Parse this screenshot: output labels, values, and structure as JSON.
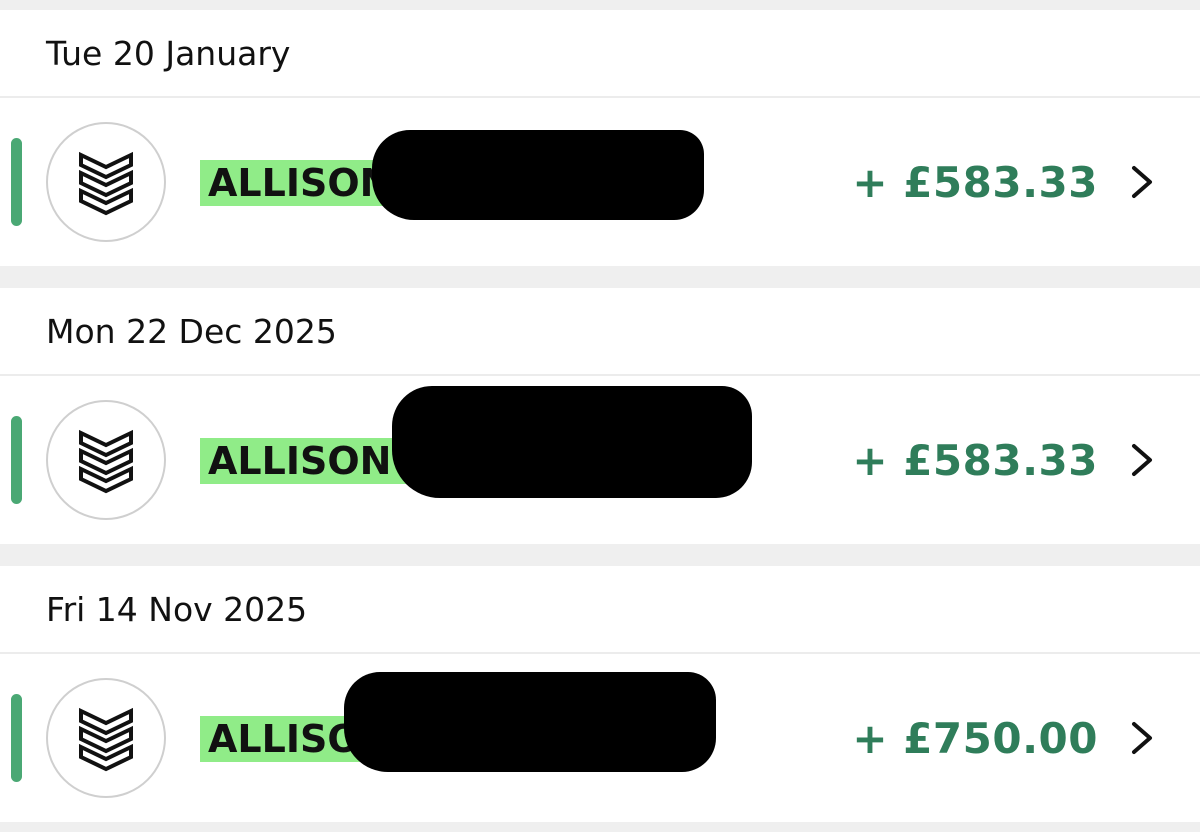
{
  "colors": {
    "accent": "#4aa874",
    "amount": "#2f7d5a",
    "highlight": "#90ec88",
    "redaction": "#000000"
  },
  "transactions": [
    {
      "date": "Tue 20 January",
      "payee": "ALLISON",
      "amount": "+ £583.33",
      "icon": "chevron-stack-icon",
      "action_icon": "chevron-right-icon"
    },
    {
      "date": "Mon 22 Dec 2025",
      "payee": "ALLISON",
      "amount": "+ £583.33",
      "icon": "chevron-stack-icon",
      "action_icon": "chevron-right-icon"
    },
    {
      "date": "Fri 14 Nov 2025",
      "payee": "ALLISO",
      "amount": "+ £750.00",
      "icon": "chevron-stack-icon",
      "action_icon": "chevron-right-icon"
    }
  ]
}
